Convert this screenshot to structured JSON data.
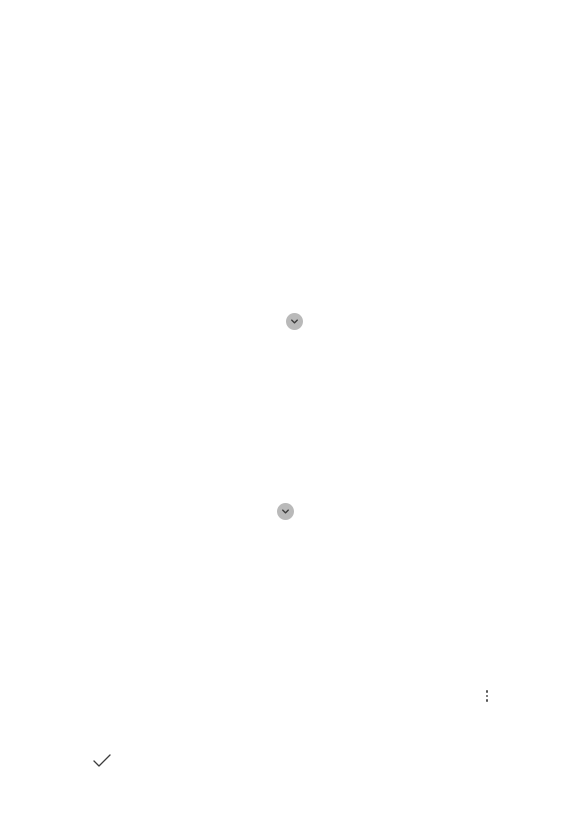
{
  "screen": {
    "background_color": "#ffffff"
  },
  "expand_buttons": [
    {
      "icon": "chevron-down-icon"
    },
    {
      "icon": "chevron-down-icon"
    }
  ],
  "overflow_menu": {
    "icon": "more-vertical-icon"
  },
  "confirm": {
    "icon": "checkmark-icon"
  },
  "colors": {
    "expand_button_fill": "#b9b9b9",
    "icon_stroke": "#3c3c3c",
    "menu_dot": "#555555"
  }
}
